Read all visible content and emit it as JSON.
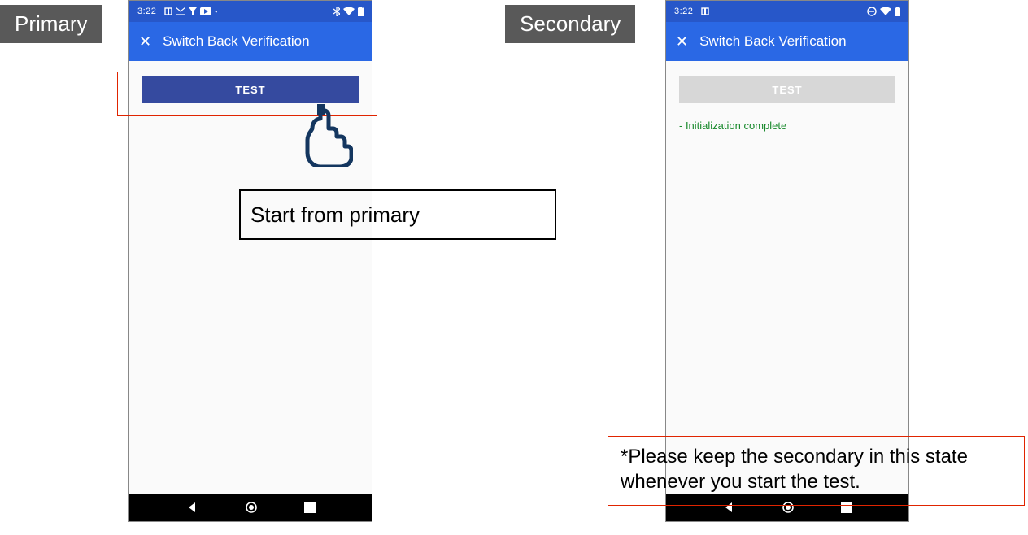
{
  "labels": {
    "primary": "Primary",
    "secondary": "Secondary"
  },
  "primary": {
    "statusTime": "3:22",
    "appTitle": "Switch Back Verification",
    "testButton": "TEST"
  },
  "secondary": {
    "statusTime": "3:22",
    "appTitle": "Switch Back Verification",
    "testButton": "TEST",
    "statusMsg": "- Initialization complete"
  },
  "annotations": {
    "startFromPrimary": "Start from primary",
    "keepSecondary": "*Please keep the secondary in this state whenever you start the test."
  }
}
